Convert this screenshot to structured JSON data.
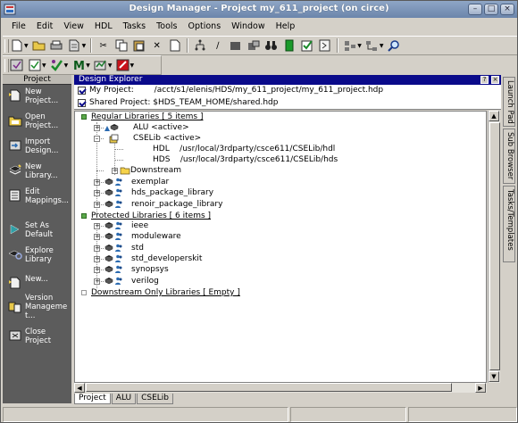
{
  "window": {
    "title": "Design Manager - Project my_611_project (on circe)"
  },
  "menu": [
    "File",
    "Edit",
    "View",
    "HDL",
    "Tasks",
    "Tools",
    "Options",
    "Window",
    "Help"
  ],
  "left_panel": {
    "title": "Project",
    "items": [
      {
        "label": "New\nProject...",
        "icon": "new-project-icon"
      },
      {
        "label": "Open\nProject...",
        "icon": "open-project-icon"
      },
      {
        "label": "Import\nDesign...",
        "icon": "import-design-icon"
      },
      {
        "label": "New\nLibrary...",
        "icon": "new-library-icon"
      },
      {
        "label": "Edit\nMappings...",
        "icon": "edit-mappings-icon"
      },
      {
        "label": "Set As\nDefault",
        "icon": "set-default-icon"
      },
      {
        "label": "Explore\nLibrary",
        "icon": "explore-library-icon"
      },
      {
        "label": "New...",
        "icon": "new-icon"
      },
      {
        "label": "Version\nManageme\nt...",
        "icon": "version-management-icon"
      },
      {
        "label": "Close\nProject",
        "icon": "close-project-icon"
      }
    ]
  },
  "explorer": {
    "title": "Design Explorer",
    "my_project": "My Project:        /acct/s1/elenis/HDS/my_611_project/my_611_project.hdp",
    "shared_project": "Shared Project: $HDS_TEAM_HOME/shared.hdp",
    "regular_header": "Regular Libraries [ 5 items ]",
    "alu": "ALU <active>",
    "cselib": "CSELib <active>",
    "hdl_row": "HDL    /usr/local/3rdparty/csce611/CSELib/hdl",
    "hds_row": "HDS    /usr/local/3rdparty/csce611/CSELib/hds",
    "downstream": "Downstream",
    "regular_libs": [
      "exemplar",
      "hds_package_library",
      "renoir_package_library"
    ],
    "protected_header": "Protected Libraries [ 6 items ]",
    "protected_libs": [
      "ieee",
      "moduleware",
      "std",
      "std_developerskit",
      "synopsys",
      "verilog"
    ],
    "downstream_header": "Downstream Only Libraries [ Empty ]"
  },
  "tabs": [
    "Project",
    "ALU",
    "CSELib"
  ],
  "right_tabs": [
    "Launch Pad",
    "Sub Browser",
    "Tasks/Templates"
  ],
  "colors": {
    "title_bar": "#7b93b7",
    "explorer_header": "#0a0a8a",
    "left_panel": "#5c5c5c",
    "check_green": "#5aa84a"
  }
}
